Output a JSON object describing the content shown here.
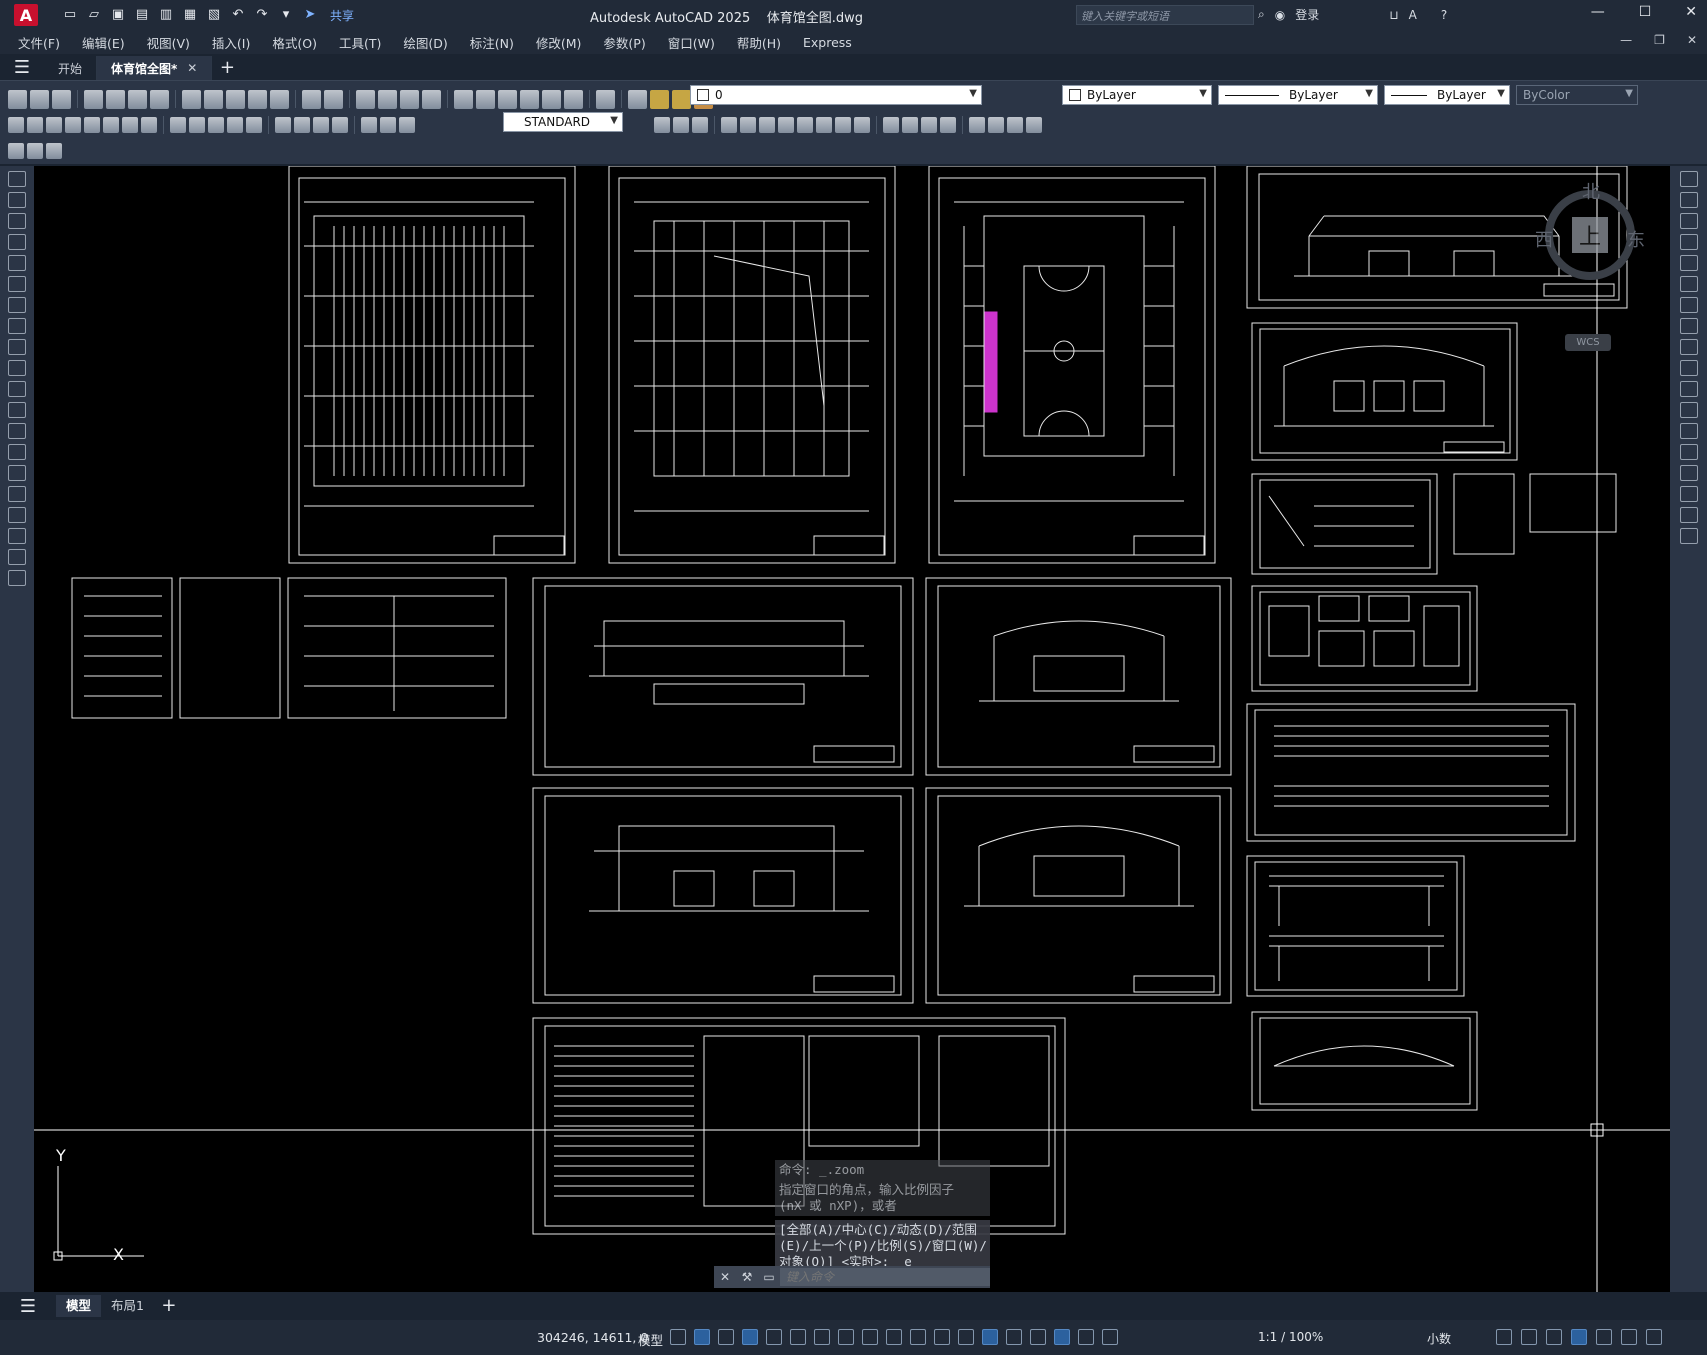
{
  "window": {
    "app_title": "Autodesk AutoCAD 2025",
    "file_name": "体育馆全图.dwg",
    "search_placeholder": "键入关键字或短语",
    "login": "登录",
    "share": "共享"
  },
  "menu": [
    "文件(F)",
    "编辑(E)",
    "视图(V)",
    "插入(I)",
    "格式(O)",
    "工具(T)",
    "绘图(D)",
    "标注(N)",
    "修改(M)",
    "参数(P)",
    "窗口(W)",
    "帮助(H)",
    "Express"
  ],
  "tabs": {
    "start": "开始",
    "active": "体育馆全图*"
  },
  "properties": {
    "layer": "0",
    "color": "ByLayer",
    "linetype": "ByLayer",
    "lineweight": "ByLayer",
    "plotstyle": "ByColor",
    "text_style": "STANDARD"
  },
  "viewcube": {
    "north": "北",
    "east": "东",
    "west": "西",
    "top": "上",
    "wcs": "WCS"
  },
  "axes": {
    "y": "Y",
    "x": "X"
  },
  "command": {
    "history1": "命令: _.zoom",
    "history2": "指定窗口的角点，输入比例因子\n(nX 或 nXP)，或者",
    "prompt": "[全部(A)/中心(C)/动态(D)/范围\n(E)/上一个(P)/比例(S)/窗口(W)/\n对象(O)] <实时>: _e",
    "input_placeholder": "键入命令"
  },
  "layout_tabs": {
    "model": "模型",
    "layout1": "布局1"
  },
  "status": {
    "coords": "304246, 14611, 0",
    "space": "模型",
    "scale": "1:1 / 100%",
    "units": "小数"
  },
  "colors": {
    "accent": "#2f6fb8",
    "canvas": "#000000",
    "ui_dark": "#212a38",
    "ui_panel": "#2b3546",
    "highlight_magenta": "#cc33cc"
  }
}
